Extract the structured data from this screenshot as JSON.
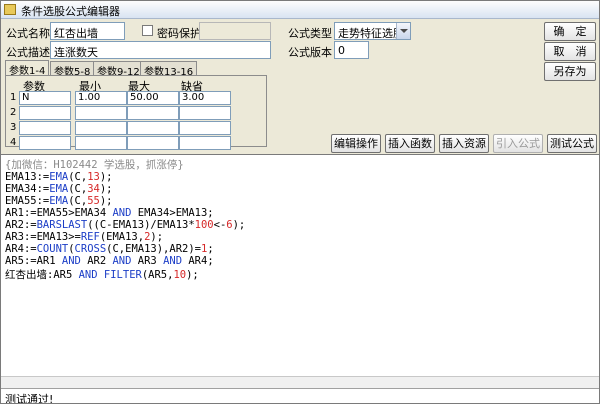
{
  "window": {
    "title": "条件选股公式编辑器"
  },
  "form": {
    "name_label": "公式名称",
    "name_value": "红杏出墙",
    "password_label": "密码保护",
    "desc_label": "公式描述",
    "desc_value": "连涨数天",
    "type_label": "公式类型",
    "type_value": "走势特征选股",
    "version_label": "公式版本",
    "version_value": "0"
  },
  "buttons": {
    "ok": "确　定",
    "cancel": "取　消",
    "save_as": "另存为",
    "edit_op": "编辑操作",
    "insert_func": "插入函数",
    "insert_res": "插入资源",
    "import_formula": "引入公式",
    "test_formula": "测试公式"
  },
  "tabs": [
    "参数1-4",
    "参数5-8",
    "参数9-12",
    "参数13-16"
  ],
  "params": {
    "headers": [
      "参数",
      "最小",
      "最大",
      "缺省"
    ],
    "rows": [
      {
        "num": "1",
        "name": "N",
        "min": "1.00",
        "max": "50.00",
        "default": "3.00"
      },
      {
        "num": "2",
        "name": "",
        "min": "",
        "max": "",
        "default": ""
      },
      {
        "num": "3",
        "name": "",
        "min": "",
        "max": "",
        "default": ""
      },
      {
        "num": "4",
        "name": "",
        "min": "",
        "max": "",
        "default": ""
      }
    ]
  },
  "code": {
    "comment": "{加微信：H102442 学选股，抓涨停}",
    "l1": [
      "EMA13:=",
      "EMA",
      "(C,",
      "13",
      ");"
    ],
    "l2": [
      "EMA34:=",
      "EMA",
      "(C,",
      "34",
      ");"
    ],
    "l3": [
      "EMA55:=",
      "EMA",
      "(C,",
      "55",
      ");"
    ],
    "l4": [
      "AR1:=EMA55>EMA34 ",
      "AND",
      " EMA34>EMA13;"
    ],
    "l5": [
      "AR2:=",
      "BARSLAST",
      "((C-EMA13)/EMA13*",
      "100",
      "<-",
      "6",
      ");"
    ],
    "l6": [
      "AR3:=EMA13>=",
      "REF",
      "(EMA13,",
      "2",
      ");"
    ],
    "l7": [
      "AR4:=",
      "COUNT",
      "(",
      "CROSS",
      "(C,EMA13),AR2)=",
      "1",
      ";"
    ],
    "l8": [
      "AR5:=AR1 ",
      "AND",
      " AR2 ",
      "AND",
      " AR3 ",
      "AND",
      " AR4;"
    ],
    "l9": [
      "红杏出墙:AR5 ",
      "AND",
      " ",
      "FILTER",
      "(AR5,",
      "10",
      ");"
    ]
  },
  "status": {
    "text": "测试通过!"
  }
}
